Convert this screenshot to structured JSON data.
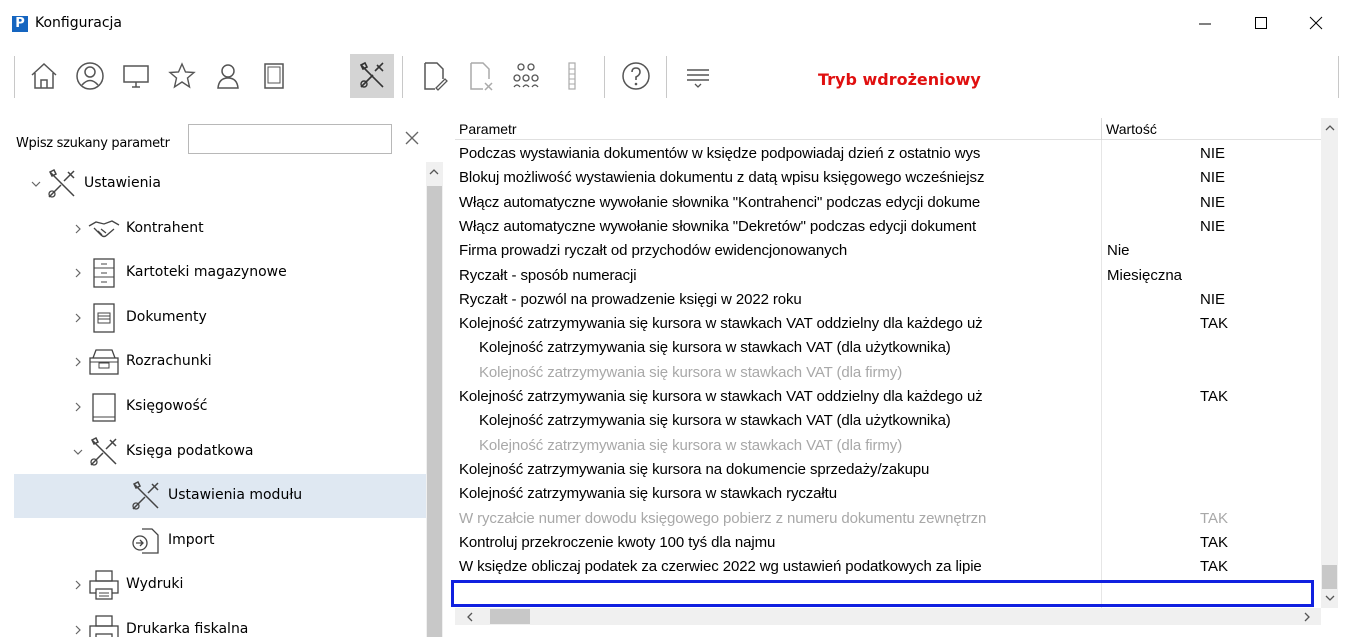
{
  "window": {
    "title": "Konfiguracja",
    "logo_letter": "P"
  },
  "toolbar": {
    "mode_label": "Tryb wdrożeniowy",
    "accent_color": "#e01010",
    "icons": [
      "home-icon",
      "user-circle-icon",
      "monitor-icon",
      "star-icon",
      "person-icon",
      "tablet-icon",
      "tools-icon",
      "document-edit-icon",
      "document-delete-icon",
      "group-icon",
      "list-icon",
      "help-icon",
      "menu-lines-icon"
    ]
  },
  "search": {
    "label": "Wpisz szukany parametr",
    "value": "",
    "placeholder": ""
  },
  "tree": {
    "items": [
      {
        "label": "Ustawienia",
        "icon": "tools-icon",
        "level": 0,
        "expanded": true
      },
      {
        "label": "Kontrahent",
        "icon": "handshake-icon",
        "level": 1,
        "expanded": false
      },
      {
        "label": "Kartoteki magazynowe",
        "icon": "cabinet-icon",
        "level": 1,
        "expanded": false
      },
      {
        "label": "Dokumenty",
        "icon": "document-icon",
        "level": 1,
        "expanded": false
      },
      {
        "label": "Rozrachunki",
        "icon": "register-icon",
        "level": 1,
        "expanded": false
      },
      {
        "label": "Księgowość",
        "icon": "book-icon",
        "level": 1,
        "expanded": false
      },
      {
        "label": "Księga podatkowa",
        "icon": "tools-icon",
        "level": 1,
        "expanded": true
      },
      {
        "label": "Ustawienia modułu",
        "icon": "tools-icon",
        "level": 2,
        "selected": true
      },
      {
        "label": "Import",
        "icon": "import-icon",
        "level": 2
      },
      {
        "label": "Wydruki",
        "icon": "printer-icon",
        "level": 1,
        "expanded": false
      },
      {
        "label": "Drukarka fiskalna",
        "icon": "printer-icon",
        "level": 1,
        "expanded": false
      }
    ]
  },
  "grid": {
    "columns": [
      "Parametr",
      "Wartość"
    ],
    "rows": [
      {
        "param": "Podczas wystawiania dokumentów w księdze podpowiadaj dzień z ostatnio wys",
        "value": "NIE",
        "align": "center",
        "indent": false,
        "disabled": false
      },
      {
        "param": "Blokuj możliwość wystawienia dokumentu z datą wpisu księgowego wcześniejsz",
        "value": "NIE",
        "align": "center",
        "indent": false,
        "disabled": false
      },
      {
        "param": "Włącz automatyczne wywołanie słownika \"Kontrahenci\" podczas edycji dokume",
        "value": "NIE",
        "align": "center",
        "indent": false,
        "disabled": false
      },
      {
        "param": "Włącz automatyczne wywołanie słownika \"Dekretów\" podczas edycji dokument",
        "value": "NIE",
        "align": "center",
        "indent": false,
        "disabled": false
      },
      {
        "param": "Firma prowadzi ryczałt od przychodów ewidencjonowanych",
        "value": "Nie",
        "align": "left",
        "indent": false,
        "disabled": false
      },
      {
        "param": "Ryczałt - sposób numeracji",
        "value": "Miesięczna",
        "align": "left",
        "indent": false,
        "disabled": false
      },
      {
        "param": "Ryczałt - pozwól na prowadzenie księgi w 2022 roku",
        "value": "NIE",
        "align": "center",
        "indent": false,
        "disabled": false
      },
      {
        "param": "Kolejność zatrzymywania się kursora w stawkach VAT oddzielny dla każdego uż",
        "value": "TAK",
        "align": "center",
        "indent": false,
        "disabled": false
      },
      {
        "param": "Kolejność zatrzymywania się kursora w stawkach VAT (dla użytkownika)",
        "value": "",
        "align": "center",
        "indent": true,
        "disabled": false
      },
      {
        "param": "Kolejność zatrzymywania się kursora w stawkach VAT (dla firmy)",
        "value": "",
        "align": "center",
        "indent": true,
        "disabled": true
      },
      {
        "param": "Kolejność zatrzymywania się kursora w stawkach VAT oddzielny dla każdego uż",
        "value": "TAK",
        "align": "center",
        "indent": false,
        "disabled": false
      },
      {
        "param": "Kolejność zatrzymywania się kursora w stawkach VAT (dla użytkownika)",
        "value": "",
        "align": "center",
        "indent": true,
        "disabled": false
      },
      {
        "param": "Kolejność zatrzymywania się kursora w stawkach VAT (dla firmy)",
        "value": "",
        "align": "center",
        "indent": true,
        "disabled": true
      },
      {
        "param": "Kolejność zatrzymywania się kursora na dokumencie sprzedaży/zakupu",
        "value": "",
        "align": "center",
        "indent": false,
        "disabled": false
      },
      {
        "param": "Kolejność zatrzymywania się kursora w stawkach ryczałtu",
        "value": "",
        "align": "center",
        "indent": false,
        "disabled": false
      },
      {
        "param": "W ryczałcie numer dowodu księgowego pobierz z numeru dokumentu zewnętrzn",
        "value": "TAK",
        "align": "center",
        "indent": false,
        "disabled": true
      },
      {
        "param": "Kontroluj przekroczenie kwoty 100 tyś dla najmu",
        "value": "TAK",
        "align": "center",
        "indent": false,
        "disabled": false
      },
      {
        "param": "W księdze obliczaj podatek za czerwiec 2022 wg ustawień podatkowych za lipie",
        "value": "TAK",
        "align": "center",
        "indent": false,
        "disabled": false,
        "highlighted": true
      }
    ],
    "highlight_color": "#1020e0"
  }
}
